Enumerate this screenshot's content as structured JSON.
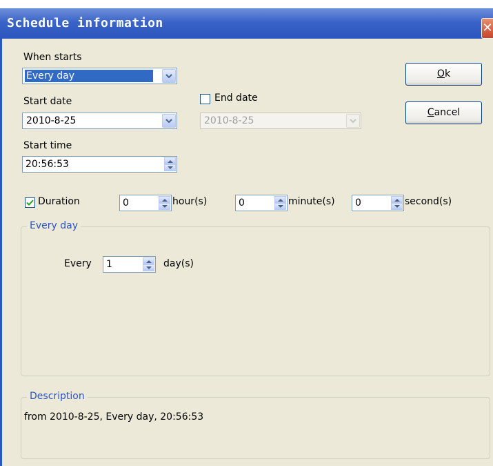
{
  "window": {
    "title": "Schedule information",
    "close_glyph": "✕"
  },
  "when_starts": {
    "label": "When starts",
    "value": "Every day"
  },
  "start_date": {
    "label": "Start date",
    "value": "2010-8-25"
  },
  "end_date": {
    "label": "End date",
    "checked": false,
    "value": "2010-8-25",
    "enabled": false
  },
  "start_time": {
    "label": "Start time",
    "value": "20:56:53"
  },
  "duration": {
    "label": "Duration",
    "checked": true,
    "hours": "0",
    "hours_unit": "hour(s)",
    "minutes": "0",
    "minutes_unit": "minute(s)",
    "seconds": "0",
    "seconds_unit": "second(s)"
  },
  "buttons": {
    "ok": {
      "accel": "O",
      "rest": "k"
    },
    "cancel": {
      "accel": "C",
      "rest": "ancel"
    }
  },
  "every_day_group": {
    "title": "Every day",
    "every_label": "Every",
    "every_value": "1",
    "unit": "day(s)"
  },
  "description_group": {
    "title": "Description",
    "text": "from 2010-8-25, Every day, 20:56:53"
  },
  "colors": {
    "title_bar": "#2c55bd",
    "dialog_bg": "#ece9d8",
    "selection": "#316ac5",
    "group_title": "#2a55c6"
  },
  "icons": [
    "close-icon",
    "dropdown-arrow-icon",
    "spin-up-icon",
    "spin-down-icon",
    "checkmark-icon"
  ]
}
